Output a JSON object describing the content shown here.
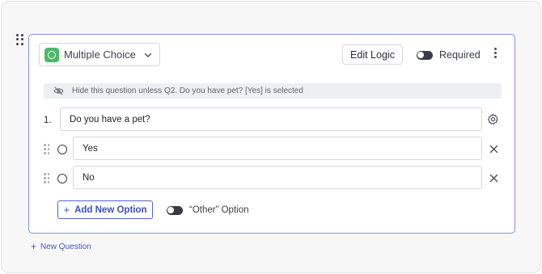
{
  "question": {
    "type_label": "Multiple Choice",
    "edit_logic_label": "Edit Logic",
    "required_label": "Required",
    "logic_notice": "Hide this question unless Q2. Do you have pet? [Yes] is selected",
    "number": "1.",
    "text": "Do you have a pet?",
    "options": [
      {
        "label": "Yes"
      },
      {
        "label": "No"
      }
    ],
    "add_option_label": "Add New Option",
    "other_option_label": "“Other” Option"
  },
  "footer": {
    "new_question_label": "New Question"
  },
  "colors": {
    "accent": "#4f64cf",
    "card_border": "#7f93e6",
    "type_icon": "#4cb86a"
  },
  "icons": [
    "drag-handle-icon",
    "radio-circle-icon",
    "chevron-down-icon",
    "toggle-icon",
    "kebab-menu-icon",
    "eye-off-icon",
    "gear-icon",
    "close-icon",
    "plus-icon"
  ]
}
